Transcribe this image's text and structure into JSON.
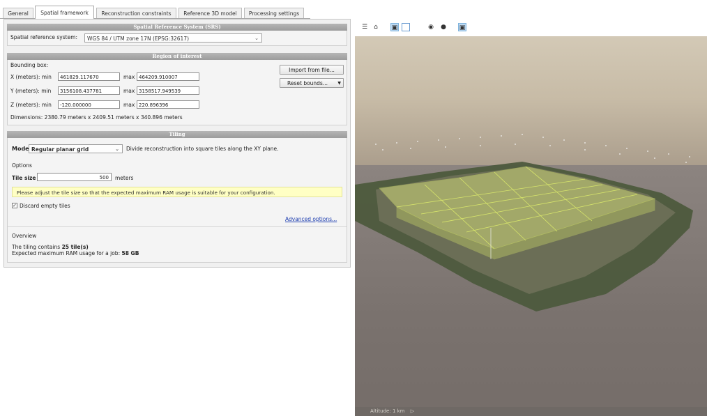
{
  "tabs": [
    {
      "label": "General",
      "active": false
    },
    {
      "label": "Spatial framework",
      "active": true
    },
    {
      "label": "Reconstruction constraints",
      "active": false
    },
    {
      "label": "Reference 3D model",
      "active": false
    },
    {
      "label": "Processing settings",
      "active": false
    }
  ],
  "srs": {
    "header": "Spatial Reference System (SRS)",
    "label": "Spatial reference system:",
    "value": "WGS 84 / UTM zone 17N (EPSG:32617)"
  },
  "roi": {
    "header": "Region of interest",
    "bbox_label": "Bounding box:",
    "x_label": "X (meters): min",
    "y_label": "Y (meters): min",
    "z_label": "Z (meters): min",
    "max_label": "max",
    "x_min": "461829.117670",
    "x_max": "464209.910007",
    "y_min": "3156108.437781",
    "y_max": "3158517.949539",
    "z_min": "-120.000000",
    "z_max": "220.896396",
    "dimensions": "Dimensions: 2380.79 meters x 2409.51 meters x 340.896 meters",
    "import_button": "Import from file...",
    "reset_button": "Reset bounds..."
  },
  "tiling": {
    "header": "Tiling",
    "mode_label": "Mode",
    "mode_value": "Regular planar grid",
    "mode_desc": "Divide reconstruction into square tiles along the XY plane.",
    "options_label": "Options",
    "tile_size_label": "Tile size",
    "tile_size_value": "500",
    "tile_size_unit": "meters",
    "hint": "Please adjust the tile size so that the expected maximum RAM usage is suitable for your configuration.",
    "discard_label": "Discard empty tiles",
    "discard_checked": true,
    "advanced_link": "Advanced options...",
    "overview_label": "Overview",
    "overview_line1_prefix": "The tiling contains",
    "overview_tiles": "25 tile(s)",
    "overview_line2_prefix": "Expected maximum RAM usage for a job:",
    "overview_ram": "58 GB"
  },
  "viewport": {
    "toolbar_icons": [
      "layers-icon",
      "home-icon",
      "cube-icon",
      "frame-icon",
      "eye-icon",
      "camera-icon",
      "tile-cube-icon"
    ],
    "status_text": "Altitude: 1 km"
  },
  "colors": {
    "section_header": "#a9a9a9",
    "hint_background": "#ffffc4",
    "link": "#1f3fb0",
    "tile_fill": "#e6f082"
  }
}
